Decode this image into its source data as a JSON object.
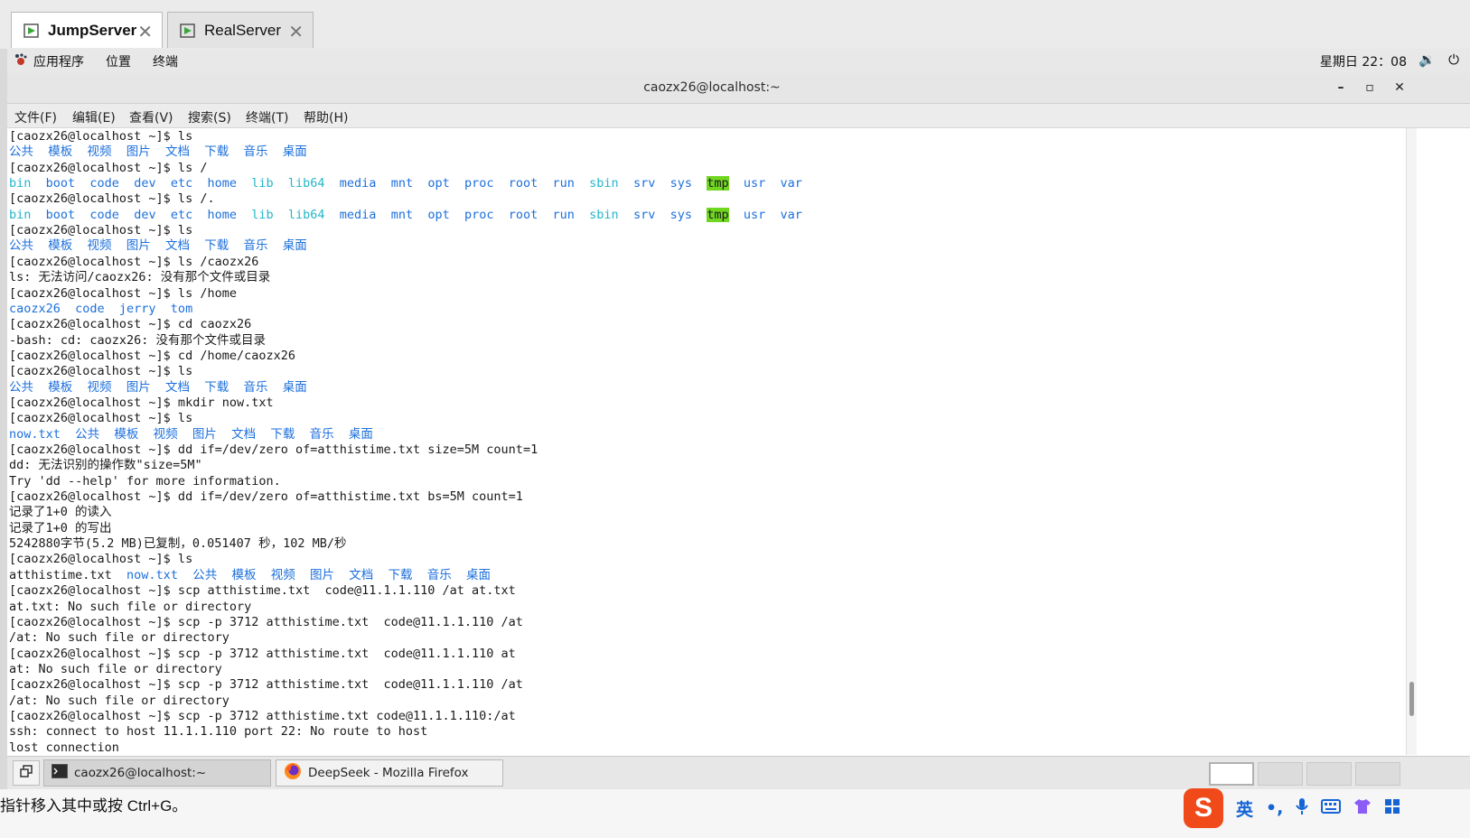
{
  "vm_tabs": [
    {
      "label": "JumpServer",
      "active": true
    },
    {
      "label": "RealServer",
      "active": false
    }
  ],
  "gnome": {
    "applications": "应用程序",
    "places": "位置",
    "terminal": "终端",
    "clock": "星期日 22：08",
    "volume_icon": "speaker-icon",
    "power_icon": "power-icon"
  },
  "window": {
    "title": "caozx26@localhost:~"
  },
  "menu": {
    "file": "文件(F)",
    "edit": "编辑(E)",
    "view": "查看(V)",
    "search": "搜索(S)",
    "terminal": "终端(T)",
    "help": "帮助(H)"
  },
  "terminal_lines": [
    [
      {
        "t": "[caozx26@localhost ~]$ ls"
      }
    ],
    [
      {
        "t": "公共  模板  视频  图片  文档  下载  音乐  桌面",
        "c": "dir"
      }
    ],
    [
      {
        "t": "[caozx26@localhost ~]$ ls /"
      }
    ],
    [
      {
        "t": "bin",
        "c": "cyan"
      },
      {
        "t": "  "
      },
      {
        "t": "boot  code  dev  etc  home",
        "c": "dir"
      },
      {
        "t": "  "
      },
      {
        "t": "lib  lib64",
        "c": "cyan"
      },
      {
        "t": "  "
      },
      {
        "t": "media  mnt  opt  proc  root  run",
        "c": "dir"
      },
      {
        "t": "  "
      },
      {
        "t": "sbin",
        "c": "cyan"
      },
      {
        "t": "  "
      },
      {
        "t": "srv  sys",
        "c": "dir"
      },
      {
        "t": "  "
      },
      {
        "t": "tmp",
        "c": "tmp"
      },
      {
        "t": "  "
      },
      {
        "t": "usr  var",
        "c": "dir"
      }
    ],
    [
      {
        "t": "[caozx26@localhost ~]$ ls /."
      }
    ],
    [
      {
        "t": "bin",
        "c": "cyan"
      },
      {
        "t": "  "
      },
      {
        "t": "boot  code  dev  etc  home",
        "c": "dir"
      },
      {
        "t": "  "
      },
      {
        "t": "lib  lib64",
        "c": "cyan"
      },
      {
        "t": "  "
      },
      {
        "t": "media  mnt  opt  proc  root  run",
        "c": "dir"
      },
      {
        "t": "  "
      },
      {
        "t": "sbin",
        "c": "cyan"
      },
      {
        "t": "  "
      },
      {
        "t": "srv  sys",
        "c": "dir"
      },
      {
        "t": "  "
      },
      {
        "t": "tmp",
        "c": "tmp"
      },
      {
        "t": "  "
      },
      {
        "t": "usr  var",
        "c": "dir"
      }
    ],
    [
      {
        "t": "[caozx26@localhost ~]$ ls"
      }
    ],
    [
      {
        "t": "公共  模板  视频  图片  文档  下载  音乐  桌面",
        "c": "dir"
      }
    ],
    [
      {
        "t": "[caozx26@localhost ~]$ ls /caozx26"
      }
    ],
    [
      {
        "t": "ls: 无法访问/caozx26: 没有那个文件或目录"
      }
    ],
    [
      {
        "t": "[caozx26@localhost ~]$ ls /home"
      }
    ],
    [
      {
        "t": "caozx26  code  jerry  tom",
        "c": "dir"
      }
    ],
    [
      {
        "t": "[caozx26@localhost ~]$ cd caozx26"
      }
    ],
    [
      {
        "t": "-bash: cd: caozx26: 没有那个文件或目录"
      }
    ],
    [
      {
        "t": "[caozx26@localhost ~]$ cd /home/caozx26"
      }
    ],
    [
      {
        "t": "[caozx26@localhost ~]$ ls"
      }
    ],
    [
      {
        "t": "公共  模板  视频  图片  文档  下载  音乐  桌面",
        "c": "dir"
      }
    ],
    [
      {
        "t": "[caozx26@localhost ~]$ mkdir now.txt"
      }
    ],
    [
      {
        "t": "[caozx26@localhost ~]$ ls"
      }
    ],
    [
      {
        "t": "now.txt  公共  模板  视频  图片  文档  下载  音乐  桌面",
        "c": "dir"
      }
    ],
    [
      {
        "t": "[caozx26@localhost ~]$ dd if=/dev/zero of=atthistime.txt size=5M count=1"
      }
    ],
    [
      {
        "t": "dd: 无法识别的操作数\"size=5M\""
      }
    ],
    [
      {
        "t": "Try 'dd --help' for more information."
      }
    ],
    [
      {
        "t": "[caozx26@localhost ~]$ dd if=/dev/zero of=atthistime.txt bs=5M count=1"
      }
    ],
    [
      {
        "t": "记录了1+0 的读入"
      }
    ],
    [
      {
        "t": "记录了1+0 的写出"
      }
    ],
    [
      {
        "t": "5242880字节(5.2 MB)已复制，0.051407 秒，102 MB/秒"
      }
    ],
    [
      {
        "t": "[caozx26@localhost ~]$ ls"
      }
    ],
    [
      {
        "t": "atthistime.txt  "
      },
      {
        "t": "now.txt  公共  模板  视频  图片  文档  下载  音乐  桌面",
        "c": "dir"
      }
    ],
    [
      {
        "t": "[caozx26@localhost ~]$ scp atthistime.txt  code@11.1.1.110 /at at.txt"
      }
    ],
    [
      {
        "t": "at.txt: No such file or directory"
      }
    ],
    [
      {
        "t": "[caozx26@localhost ~]$ scp -p 3712 atthistime.txt  code@11.1.1.110 /at"
      }
    ],
    [
      {
        "t": "/at: No such file or directory"
      }
    ],
    [
      {
        "t": "[caozx26@localhost ~]$ scp -p 3712 atthistime.txt  code@11.1.1.110 at"
      }
    ],
    [
      {
        "t": "at: No such file or directory"
      }
    ],
    [
      {
        "t": "[caozx26@localhost ~]$ scp -p 3712 atthistime.txt  code@11.1.1.110 /at"
      }
    ],
    [
      {
        "t": "/at: No such file or directory"
      }
    ],
    [
      {
        "t": "[caozx26@localhost ~]$ scp -p 3712 atthistime.txt code@11.1.1.110:/at"
      }
    ],
    [
      {
        "t": "ssh: connect to host 11.1.1.110 port 22: No route to host"
      }
    ],
    [
      {
        "t": "lost connection"
      }
    ]
  ],
  "taskbar": {
    "show_desktop_icon": "show-desktop-icon",
    "items": [
      {
        "label": "caozx26@localhost:~",
        "icon": "terminal-icon",
        "active": true
      },
      {
        "label": "DeepSeek - Mozilla Firefox",
        "icon": "firefox-icon",
        "active": false
      }
    ],
    "workspaces": 4
  },
  "hint": "指针移入其中或按 Ctrl+G。",
  "ime": {
    "logo": "S",
    "mode": "英",
    "punct": "•,",
    "mic_icon": "microphone-icon",
    "keyboard_icon": "keyboard-icon",
    "skin_icon": "shirt-icon",
    "menu_icon": "grid-icon"
  },
  "colors": {
    "dir": "#1c6fdc",
    "cyan": "#23b6c9",
    "tmp_bg": "#71d620",
    "ime": "#f04a1a"
  }
}
